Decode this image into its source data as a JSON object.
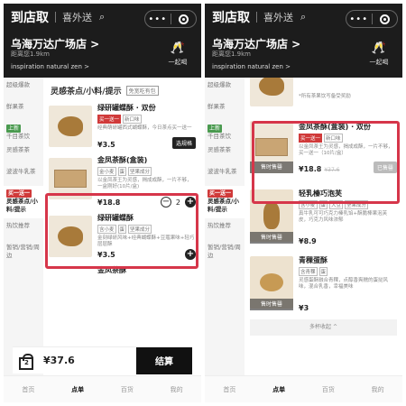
{
  "header": {
    "tab_active": "到店取",
    "tab_inactive": "喜外送",
    "store_name": "乌海万达广场店 >",
    "distance": "距离您1.9km",
    "slogan": "inspiration natural zen >",
    "cheers_label": "一起喝"
  },
  "left": {
    "sidebar": [
      {
        "label": "超级爆款"
      },
      {
        "label": "鲜果茶"
      },
      {
        "label": "千目茶饮",
        "badge": "上新"
      },
      {
        "label": "灵感茶茶"
      },
      {
        "label": "波波牛乳茶"
      },
      {
        "label": "灵感茶点/小料/提示",
        "badge": "买一送一"
      },
      {
        "label": "热饮推荐"
      },
      {
        "label": "暂销/营销/周边"
      }
    ],
    "section_title": "灵感茶点/小料/提示",
    "section_tag": "免宽吃有包",
    "items": [
      {
        "name": "绿研罐蝶酥 · 双份",
        "tags": [
          "买一送一",
          "新口味"
        ],
        "desc": "经典萌研罐西式蝴蝶酥，今日茶点买一送一",
        "price": "¥3.5",
        "button": "选规格"
      },
      {
        "name": "金凤茶酥(盒装)",
        "tags": [
          "金小麦",
          "蛋",
          "坚果成分"
        ],
        "desc": "以金凤茶王为灵感，揭成成酥，一片不够，一盒刚好(10片/盒)",
        "price": "¥18.8",
        "quantity": "2"
      },
      {
        "name": "绿研罐蝶酥",
        "tags": [
          "含小麦",
          "蛋",
          "坚果成分"
        ],
        "desc": "金刻绿研风味+经典蝴蝶酥+豆蔻果味+轻巧层层酥",
        "price": "¥3.5"
      },
      {
        "name": "金凤茶酥"
      }
    ],
    "cart": {
      "count": "2",
      "total": "¥37.6",
      "checkout": "结算"
    }
  },
  "right": {
    "sidebar": [
      {
        "label": "超级爆款"
      },
      {
        "label": "鲜果茶"
      },
      {
        "label": "千目茶饮",
        "badge": "上新"
      },
      {
        "label": "灵感茶茶"
      },
      {
        "label": "波波牛乳茶"
      },
      {
        "label": "灵感茶点/小料/提示",
        "badge": "买一送一"
      },
      {
        "label": "热饮推荐"
      },
      {
        "label": "暂销/营销/周边"
      }
    ],
    "top_desc": "*所有茶果饮写备受奖励",
    "items": [
      {
        "name": "金凤茶酥(盒装) · 双份",
        "tags": [
          "买一送一",
          "新口味"
        ],
        "desc": "以金凤茶王为灵感，揭成成酥，一片不够，买一送一（10片/盒）",
        "price": "¥18.8",
        "old_price": "¥37.6",
        "soldout": "售时售罄",
        "button": "已售罄"
      },
      {
        "name": "轻乳榛巧泡芙",
        "tags": [
          "含小麦",
          "蛋",
          "大豆",
          "坚果成分"
        ],
        "desc": "真牛乳可可巧克力榛乳馅+酥脆棒果泡芙皮，巧克力风味浓郁",
        "price": "¥8.9",
        "soldout": "售时售罄"
      },
      {
        "name": "青稞蛋酥",
        "tags": [
          "含青稞",
          "蛋"
        ],
        "desc": "灵感蛋酥融合青稞，点醇香爽糯的蛋挞风味，混合乳香，幸福美味",
        "price": "¥3",
        "soldout": "售时售罄"
      }
    ],
    "collapse": "多杯收起 ^"
  },
  "tabs": [
    "首页",
    "点单",
    "百货",
    "我的"
  ],
  "active_tab_index": 1,
  "colors": {
    "header_bg": "#1c1c1c",
    "highlight": "#d6364a",
    "badge_new": "#4a9a4f",
    "badge_promo": "#d03a3a"
  }
}
